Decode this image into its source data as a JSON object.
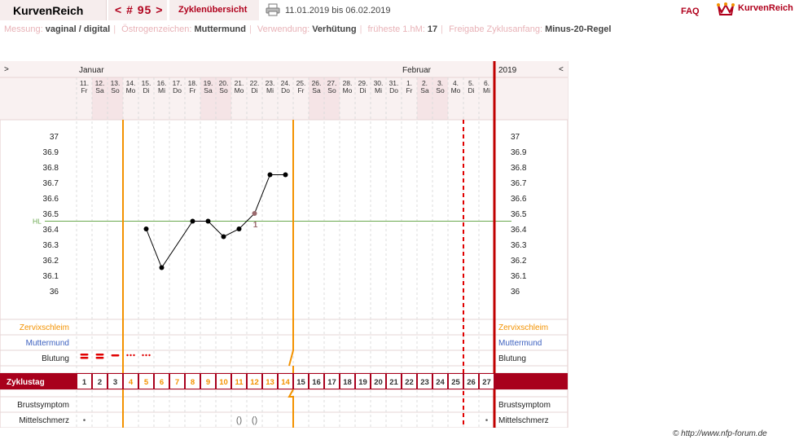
{
  "header": {
    "logo": "KurvenReich",
    "cycle_nav": "< # 95 >",
    "overview_link": "Zyklenübersicht",
    "date_range": "11.01.2019 bis 06.02.2019",
    "faq": "FAQ",
    "brand": "KurvenReich",
    "print_icon": "printer-icon",
    "brand_icon": "crown-icon"
  },
  "info": {
    "messung_label": "Messung:",
    "messung_value": "vaginal / digital",
    "oestrogen_label": "Östrogenzeichen:",
    "oestrogen_value": "Muttermund",
    "verwendung_label": "Verwendung:",
    "verwendung_value": "Verhütung",
    "fhm_label": "früheste 1.hM:",
    "fhm_value": "17",
    "freigabe_label": "Freigabe Zyklusanfang:",
    "freigabe_value": "Minus-20-Regel"
  },
  "chart": {
    "nav_prev": ">",
    "nav_next": "<",
    "month_1": "Januar",
    "month_2": "Februar",
    "year": "2019",
    "days": [
      {
        "d": "11.",
        "w": "Fr",
        "we": false
      },
      {
        "d": "12.",
        "w": "Sa",
        "we": true
      },
      {
        "d": "13.",
        "w": "So",
        "we": true
      },
      {
        "d": "14.",
        "w": "Mo",
        "we": false
      },
      {
        "d": "15.",
        "w": "Di",
        "we": false
      },
      {
        "d": "16.",
        "w": "Mi",
        "we": false
      },
      {
        "d": "17.",
        "w": "Do",
        "we": false
      },
      {
        "d": "18.",
        "w": "Fr",
        "we": false
      },
      {
        "d": "19.",
        "w": "Sa",
        "we": true
      },
      {
        "d": "20.",
        "w": "So",
        "we": true
      },
      {
        "d": "21.",
        "w": "Mo",
        "we": false
      },
      {
        "d": "22.",
        "w": "Di",
        "we": false
      },
      {
        "d": "23.",
        "w": "Mi",
        "we": false
      },
      {
        "d": "24.",
        "w": "Do",
        "we": false
      },
      {
        "d": "25.",
        "w": "Fr",
        "we": false
      },
      {
        "d": "26.",
        "w": "Sa",
        "we": true
      },
      {
        "d": "27.",
        "w": "So",
        "we": true
      },
      {
        "d": "28.",
        "w": "Mo",
        "we": false
      },
      {
        "d": "29.",
        "w": "Di",
        "we": false
      },
      {
        "d": "30.",
        "w": "Mi",
        "we": false
      },
      {
        "d": "31.",
        "w": "Do",
        "we": false
      },
      {
        "d": "1.",
        "w": "Fr",
        "we": false
      },
      {
        "d": "2.",
        "w": "Sa",
        "we": true
      },
      {
        "d": "3.",
        "w": "So",
        "we": true
      },
      {
        "d": "4.",
        "w": "Mo",
        "we": false
      },
      {
        "d": "5.",
        "w": "Di",
        "we": false
      },
      {
        "d": "6.",
        "w": "Mi",
        "we": false
      }
    ],
    "temp_ticks": [
      "37",
      "36.9",
      "36.8",
      "36.7",
      "36.6",
      "36.5",
      "36.4",
      "36.3",
      "36.2",
      "36.1",
      "36"
    ],
    "temperatures": [
      null,
      null,
      null,
      null,
      36.4,
      36.15,
      null,
      36.45,
      36.45,
      36.35,
      36.4,
      36.5,
      36.75,
      36.75,
      null,
      null,
      null,
      null,
      null,
      null,
      null,
      null,
      null,
      null,
      null,
      null,
      null
    ],
    "hl_label": "HL",
    "hl_value": 36.45,
    "marker_day": 12,
    "marker_label": "1",
    "rows": {
      "zervix": "Zervixschleim",
      "muttermund": "Muttermund",
      "blutung": "Blutung",
      "zyklustag": "Zyklustag",
      "brust": "Brustsymptom",
      "mittel": "Mittelschmerz"
    },
    "blutung_levels": [
      "strong",
      "strong",
      "medium",
      "light",
      "light"
    ],
    "mittelschmerz_marks": [
      {
        "day": 1,
        "sym": "•"
      },
      {
        "day": 11,
        "sym": "()"
      },
      {
        "day": 12,
        "sym": "()"
      },
      {
        "day": 27,
        "sym": "•"
      }
    ],
    "cycle_days": [
      "1",
      "2",
      "3",
      "4",
      "5",
      "6",
      "7",
      "8",
      "9",
      "10",
      "11",
      "12",
      "13",
      "14",
      "15",
      "16",
      "17",
      "18",
      "19",
      "20",
      "21",
      "22",
      "23",
      "24",
      "25",
      "26",
      "27"
    ],
    "orange_days": [
      4,
      5,
      6,
      7,
      8,
      9,
      10,
      11,
      12,
      13,
      14
    ],
    "colors": {
      "accent": "#b0001c",
      "weekend": "#f5e4e6",
      "orange": "#f39200",
      "zervix": "#f39200",
      "muttermund": "#3e62c0",
      "hl_line": "#6aa84f"
    }
  },
  "copyright": "© http://www.nfp-forum.de"
}
